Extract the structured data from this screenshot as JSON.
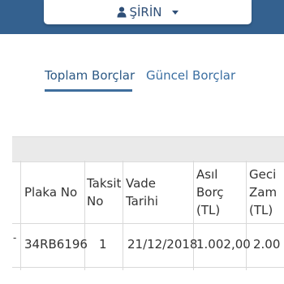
{
  "header": {
    "user_name": "ŞİRİN",
    "bar_color": "#34618f"
  },
  "tabs": [
    {
      "label": "Toplam Borçlar",
      "active": true
    },
    {
      "label": "Güncel Borçlar",
      "active": false
    }
  ],
  "table": {
    "columns": {
      "plaka": "Plaka No",
      "taksit_line1": "Taksit",
      "taksit_line2": "No",
      "vade_line1": "Vade",
      "vade_line2": "Tarihi",
      "asil_line1": "Asıl",
      "asil_line2": "Borç",
      "asil_line3": "(TL)",
      "gecikme_line1": "Geci",
      "gecikme_line2": "Zam",
      "gecikme_line3": "(TL)"
    },
    "row": {
      "marker": "-",
      "plaka": "34RB6196",
      "taksit": "1",
      "vade": "21/12/2018",
      "asil": "1.002,00",
      "gecikme": "2.00"
    }
  }
}
